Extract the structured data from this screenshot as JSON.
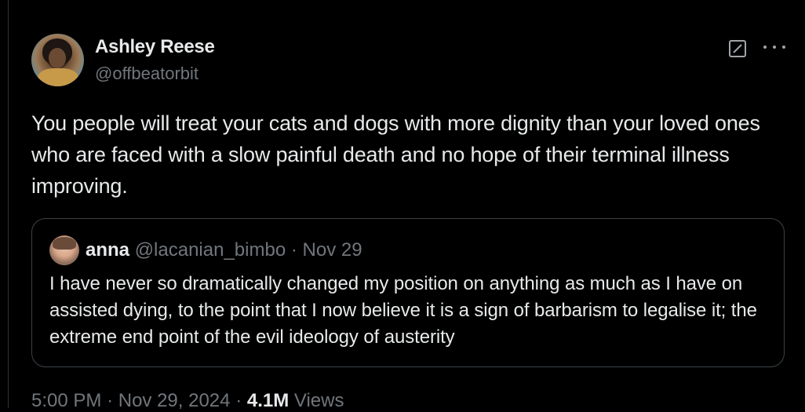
{
  "tweet": {
    "author": {
      "name": "Ashley Reese",
      "handle": "@offbeatorbit"
    },
    "text": "You people will treat your cats and dogs with more dignity than your loved ones who are faced with a slow painful death and no hope of their terminal illness improving.",
    "icons": {
      "grok": "grok-icon",
      "more": "more-options-icon"
    },
    "quoted": {
      "name": "anna",
      "handle": "@lacanian_bimbo",
      "separator": "·",
      "date": "Nov 29",
      "text": "I have never so dramatically changed my position on anything as much as I have on assisted dying, to the point that I now believe it is a sign of barbarism to legalise it; the extreme end point of the evil ideology of austerity"
    },
    "footer": {
      "time": "5:00 PM",
      "sep1": "·",
      "date": "Nov 29, 2024",
      "sep2": "·",
      "views_count": "4.1M",
      "views_label": "Views"
    }
  },
  "colors": {
    "background": "#000000",
    "text_primary": "#e7e9ea",
    "text_secondary": "#71767b",
    "border": "#3d4246"
  }
}
